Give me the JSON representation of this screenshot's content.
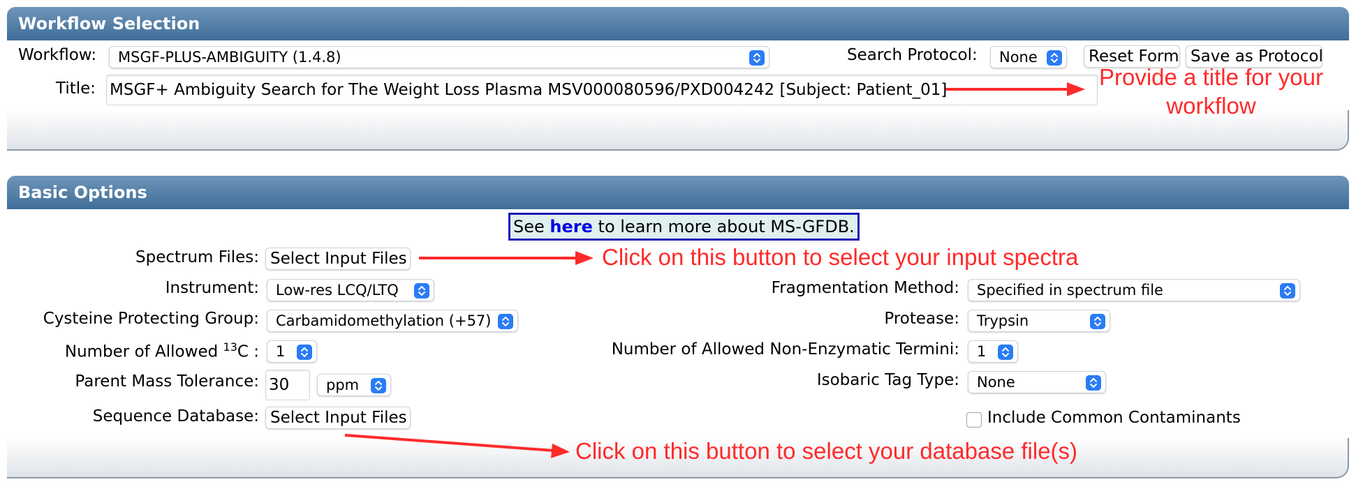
{
  "workflow_panel": {
    "header": "Workflow Selection",
    "workflow_label": "Workflow:",
    "workflow_value": "MSGF-PLUS-AMBIGUITY (1.4.8)",
    "search_protocol_label": "Search Protocol:",
    "search_protocol_value": "None",
    "reset_button": "Reset Form",
    "save_button": "Save as Protocol",
    "title_label": "Title:",
    "title_value": "MSGF+ Ambiguity Search for The Weight Loss Plasma MSV000080596/PXD004242 [Subject: Patient_01]",
    "title_annotation_line1": "Provide a title for your",
    "title_annotation_line2": "workflow"
  },
  "basic_panel": {
    "header": "Basic Options",
    "info": {
      "prefix": "See",
      "link": "here",
      "suffix": "to learn more about MS-GFDB."
    },
    "spectrum_files_label": "Spectrum Files:",
    "spectrum_files_button": "Select Input Files",
    "spectrum_annotation": "Click on this button to select your input spectra",
    "instrument_label": "Instrument:",
    "instrument_value": "Low-res LCQ/LTQ",
    "fragmentation_label": "Fragmentation Method:",
    "fragmentation_value": "Specified in spectrum file",
    "cysteine_label": "Cysteine Protecting Group:",
    "cysteine_value": "Carbamidomethylation (+57)",
    "protease_label": "Protease:",
    "protease_value": "Trypsin",
    "c13_label_prefix": "Number of Allowed ",
    "c13_label_sup": "13",
    "c13_label_suffix": "C :",
    "c13_value": "1",
    "nonenzymatic_label": "Number of Allowed Non-Enzymatic Termini:",
    "nonenzymatic_value": "1",
    "parent_mass_label": "Parent Mass Tolerance:",
    "parent_mass_value": "30",
    "parent_mass_unit": "ppm",
    "isobaric_label": "Isobaric Tag Type:",
    "isobaric_value": "None",
    "sequence_db_label": "Sequence Database:",
    "sequence_db_button": "Select Input Files",
    "contaminants_label": "Include Common Contaminants",
    "contaminants_checked": false,
    "database_annotation": "Click on this button to select your database file(s)"
  },
  "colors": {
    "header_gradient_top": "#6f95b9",
    "header_gradient_bottom": "#3f6e99",
    "annotation_red": "#ff2a2a",
    "select_chevron_blue": "#2a7cf6",
    "link_blue": "#0000e6"
  }
}
